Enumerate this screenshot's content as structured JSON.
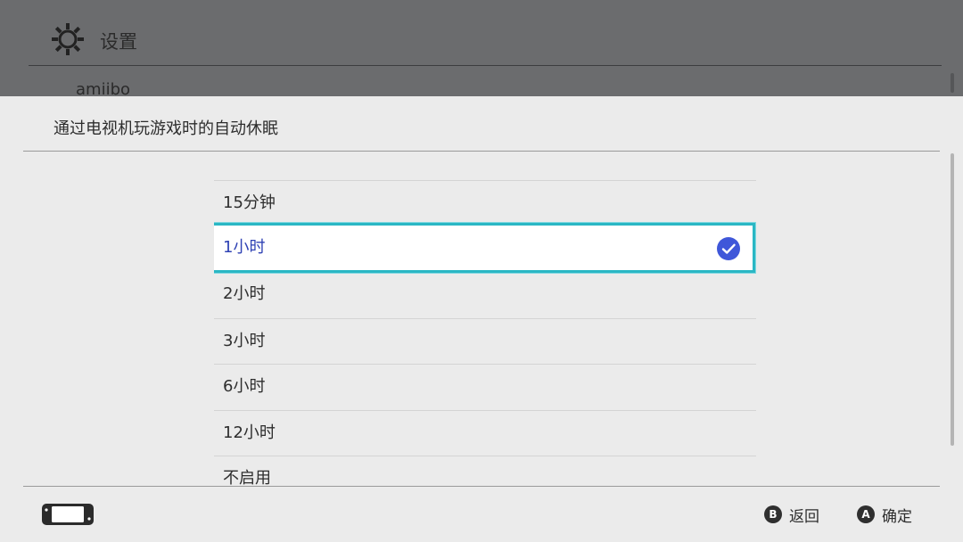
{
  "background": {
    "title": "设置",
    "peek_item": "amiibo",
    "gear_icon": "gear-icon"
  },
  "dialog": {
    "title": "通过电视机玩游戏时的自动休眠",
    "options": [
      {
        "label": "15分钟",
        "selected": false
      },
      {
        "label": "1小时",
        "selected": true
      },
      {
        "label": "2小时",
        "selected": false
      },
      {
        "label": "3小时",
        "selected": false
      },
      {
        "label": "6小时",
        "selected": false
      },
      {
        "label": "12小时",
        "selected": false
      },
      {
        "label": "不启用",
        "selected": false
      }
    ]
  },
  "footer": {
    "console_icon": "console-icon",
    "back": {
      "glyph": "B",
      "label": "返回"
    },
    "confirm": {
      "glyph": "A",
      "label": "确定"
    }
  },
  "colors": {
    "accent_focus": "#2ab7c4",
    "selected_text": "#2f42b4",
    "check_fill": "#3f57d9"
  }
}
